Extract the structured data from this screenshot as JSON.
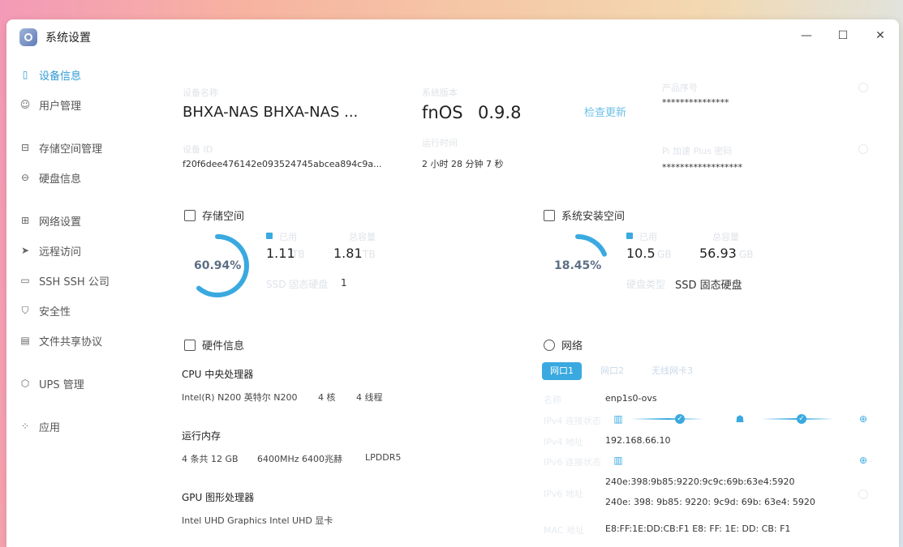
{
  "window": {
    "title": "系统设置",
    "min_icon": "—",
    "max_icon": "☐",
    "close_icon": "✕"
  },
  "sidebar": {
    "items": [
      {
        "label": "设备信息",
        "icon": "device-icon"
      },
      {
        "label": "用户管理",
        "icon": "user-icon"
      },
      {
        "label": "存储空间管理",
        "icon": "storage-icon"
      },
      {
        "label": "硬盘信息",
        "icon": "disk-icon"
      },
      {
        "label": "网络设置",
        "icon": "network-icon"
      },
      {
        "label": "远程访问",
        "icon": "remote-icon"
      },
      {
        "label": "SSH    SSH 公司",
        "icon": "ssh-icon"
      },
      {
        "label": "安全性",
        "icon": "shield-icon"
      },
      {
        "label": "文件共享协议",
        "icon": "file-share-icon"
      },
      {
        "label": "UPS 管理",
        "icon": "ups-icon"
      },
      {
        "label": "应用",
        "icon": "apps-icon"
      }
    ]
  },
  "device": {
    "name_label": "设备名称",
    "name": "BHXA-NAS  BHXA-NAS ...",
    "id_label": "设备 ID",
    "id": "f20f6dee476142e093524745abcea894c9a...",
    "system_label": "系统版本",
    "os": "fnOS",
    "version": "0.9.8",
    "check_update": "检查更新",
    "uptime_label": "运行时间",
    "uptime": "2 小时 28 分钟 7 秒",
    "serial_label": "产品序号",
    "serial": "***************",
    "mac_label": "Pi 加速 Plus 密码",
    "mac": "******************"
  },
  "storage": {
    "title": "存储空间",
    "percent": "60.94%",
    "percent_value": 60.94,
    "used_label": "已用",
    "used": "1.11",
    "used_unit": "TB",
    "total_label": "总容量",
    "total": "1.81",
    "total_unit": "TB",
    "type_label": "SSD  固态硬盘",
    "type_count": "1"
  },
  "system_storage": {
    "title": "系统安装空间",
    "percent": "18.45%",
    "percent_value": 18.45,
    "used_label": "已用",
    "used": "10.5",
    "used_unit": "GB",
    "total_label": "总容量",
    "total": "56.93",
    "total_unit": "GB",
    "type_label": "硬盘类型",
    "type": "SSD  固态硬盘"
  },
  "hardware": {
    "title": "硬件信息",
    "cpu_title": "CPU  中央处理器",
    "cpu_model": "Intel(R) N200  英特尔 N200",
    "cpu_cores": "4 核",
    "cpu_threads": "4 线程",
    "mem_title": "运行内存",
    "mem_size": "4 条共 12 GB",
    "mem_freq": "6400MHz  6400兆赫",
    "mem_type": "LPDDR5",
    "gpu_title": "GPU  图形处理器",
    "gpu_model": "Intel UHD Graphics  Intel UHD 显卡"
  },
  "network": {
    "title": "网络",
    "tabs": [
      "网口1",
      "网口2",
      "无线网卡3"
    ],
    "name_label": "名称",
    "name": "enp1s0-ovs",
    "ipv4_status_label": "IPv4 连接状态",
    "ipv4_label": "IPv4 地址",
    "ipv4": "192.168.66.10",
    "ipv6_status_label": "IPv6 连接状态",
    "ipv6_label": "IPv6 地址",
    "ipv6_a": "240e:398:9b85:9220:9c9c:69b:63e4:5920",
    "ipv6_b": "240e: 398: 9b85: 9220: 9c9d: 69b: 63e4: 5920",
    "mac_label": "MAC 地址",
    "mac": "E8:FF:1E:DD:CB:F1  E8: FF: 1E: DD: CB: F1"
  },
  "colors": {
    "accent": "#3aa9e0",
    "donut_track": "#ffffff"
  }
}
